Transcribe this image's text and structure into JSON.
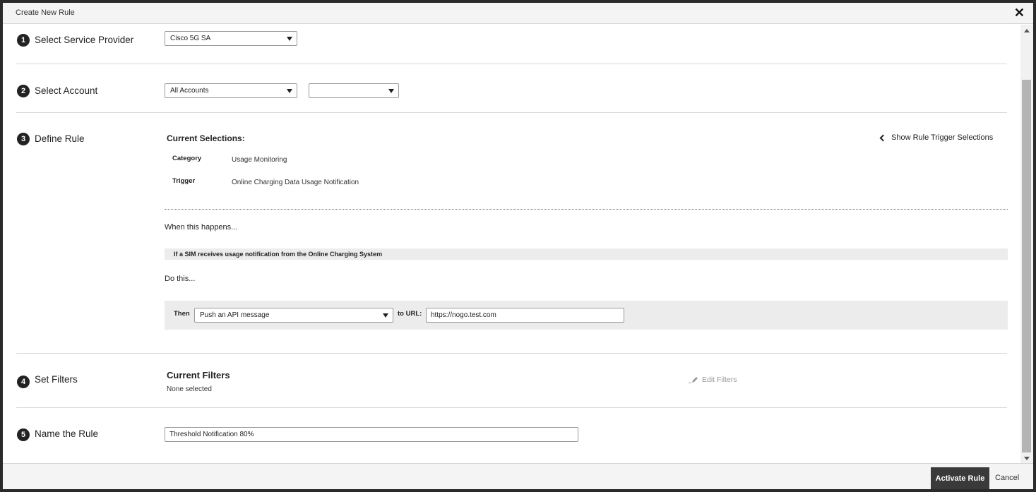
{
  "dialog": {
    "title": "Create New Rule",
    "close_icon": "close-icon"
  },
  "steps": [
    {
      "number": "1",
      "label": "Select Service Provider"
    },
    {
      "number": "2",
      "label": "Select Account"
    },
    {
      "number": "3",
      "label": "Define Rule"
    },
    {
      "number": "4",
      "label": "Set Filters"
    },
    {
      "number": "5",
      "label": "Name the Rule"
    }
  ],
  "service_provider": {
    "selected": "Cisco 5G SA"
  },
  "account": {
    "selected": "All Accounts",
    "secondary_selected": ""
  },
  "define_rule": {
    "current_selections_heading": "Current Selections:",
    "show_triggers_label": "Show Rule Trigger Selections",
    "category_key": "Category",
    "category_value": "Usage Monitoring",
    "trigger_key": "Trigger",
    "trigger_value": "Online Charging Data Usage Notification",
    "when_heading": "When this happens...",
    "condition": "If a SIM receives usage notification from the Online Charging System",
    "do_heading": "Do this...",
    "then_label": "Then",
    "action_selected": "Push an API message",
    "to_url_label": "to URL:",
    "url_value": "https://nogo.test.com"
  },
  "filters": {
    "heading": "Current Filters",
    "status": "None selected",
    "edit_label": "Edit Filters"
  },
  "rule_name": {
    "value": "Threshold Notification 80%"
  },
  "footer": {
    "activate_label": "Activate Rule",
    "cancel_label": "Cancel"
  },
  "colors": {
    "activate_button_bg": "#3a3a3a",
    "badge_bg": "#222222",
    "panel_bg": "#ececec"
  }
}
